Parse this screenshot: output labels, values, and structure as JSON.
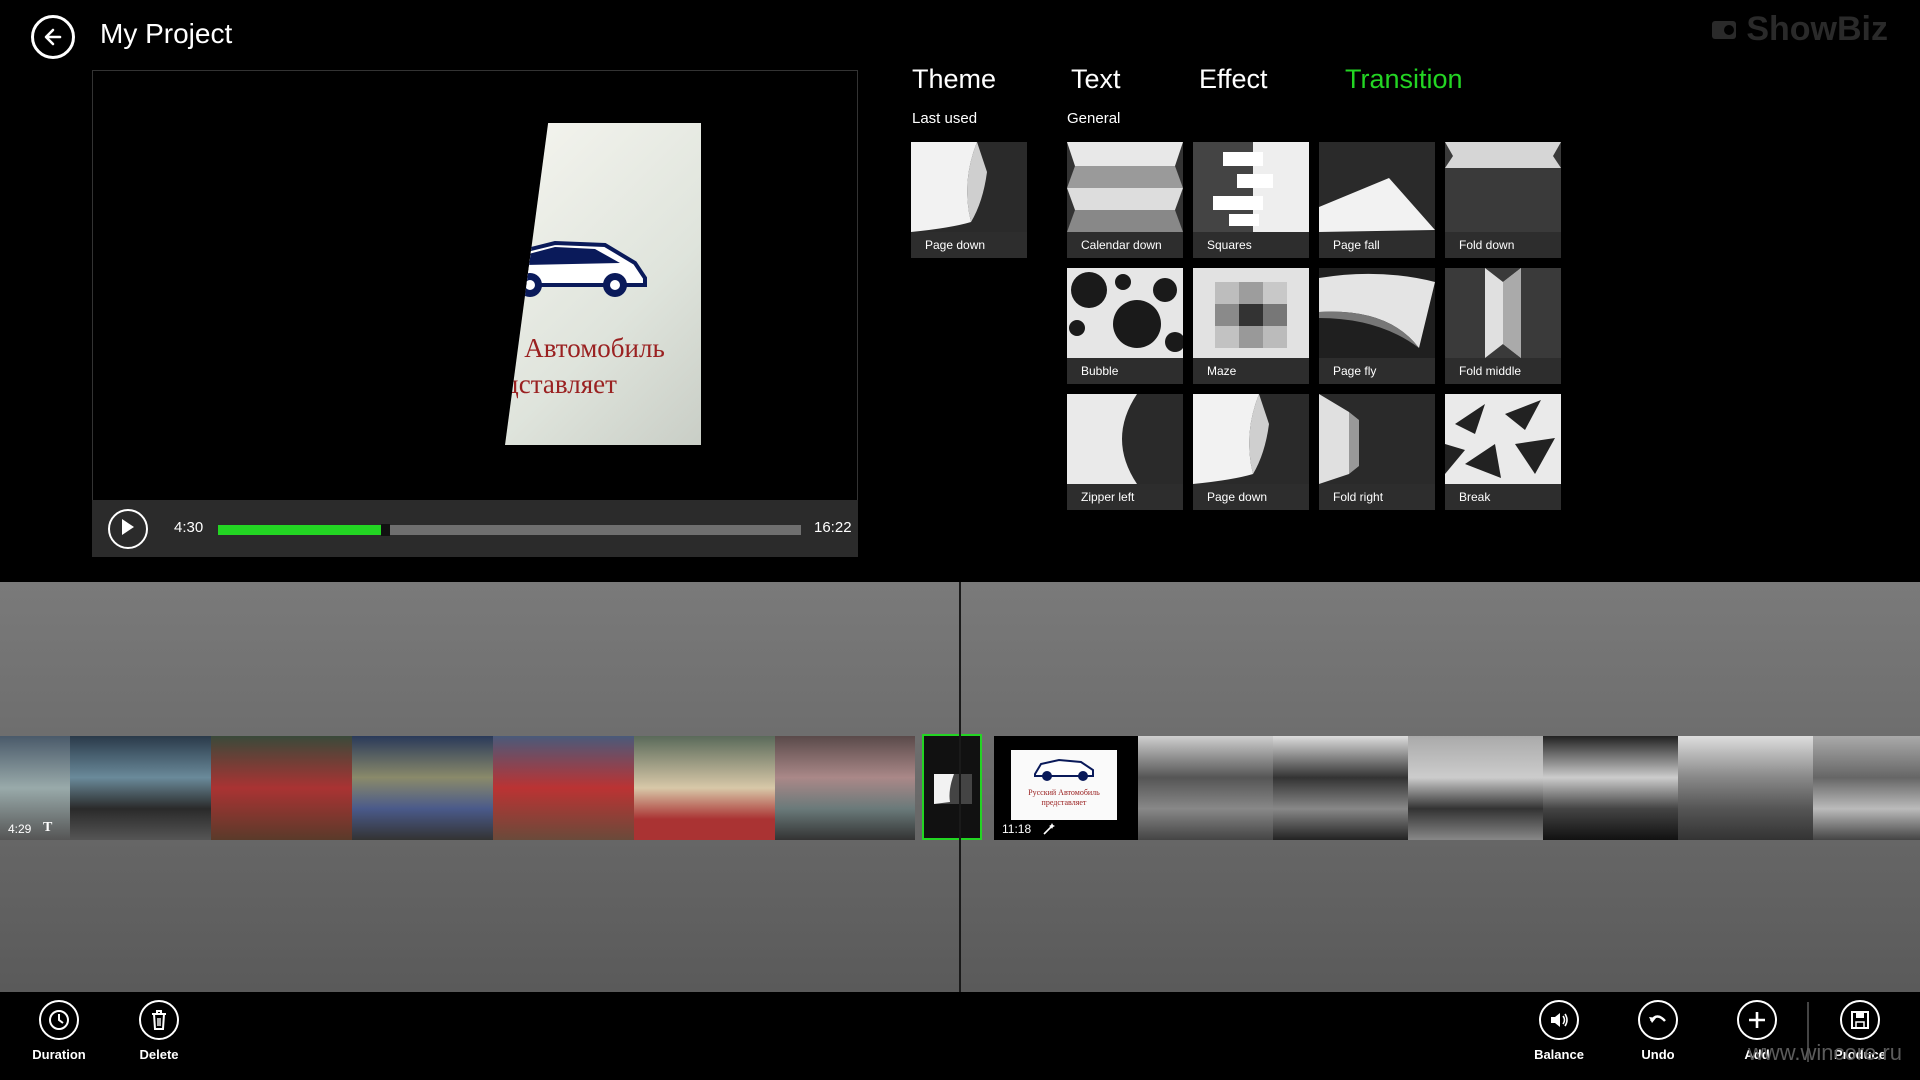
{
  "header": {
    "title": "My Project",
    "logo": "ShowBiz"
  },
  "preview": {
    "card_line1": "н Автомобиль",
    "card_line2": "дставляет",
    "time_current": "4:30",
    "time_total": "16:22",
    "progress": 0.28
  },
  "tabs": [
    {
      "label": "Theme",
      "active": false
    },
    {
      "label": "Text",
      "active": false
    },
    {
      "label": "Effect",
      "active": false
    },
    {
      "label": "Transition",
      "active": true
    }
  ],
  "accent_color": "#23d523",
  "last_used": {
    "label": "Last used",
    "items": [
      "Page down"
    ]
  },
  "general": {
    "label": "General",
    "items": [
      "Calendar down",
      "Squares",
      "Page fall",
      "Fold down",
      "Bubble",
      "Maze",
      "Page fly",
      "Fold middle",
      "Zipper left",
      "Page down",
      "Fold right",
      "Break"
    ]
  },
  "timeline": {
    "left_clip_duration": "4:29",
    "left_clip_text_icon": "T",
    "right_clip_duration": "11:18",
    "right_card_line1": "Русский Автомобиль",
    "right_card_line2": "представляет"
  },
  "appbar": {
    "left": [
      {
        "label": "Duration",
        "icon": "clock-icon"
      },
      {
        "label": "Delete",
        "icon": "trash-icon"
      }
    ],
    "right": [
      {
        "label": "Balance",
        "icon": "speaker-icon"
      },
      {
        "label": "Undo",
        "icon": "undo-icon"
      },
      {
        "label": "Add",
        "icon": "plus-icon"
      },
      {
        "label": "Produce",
        "icon": "save-icon"
      }
    ]
  },
  "watermark": "www.wincore.ru"
}
